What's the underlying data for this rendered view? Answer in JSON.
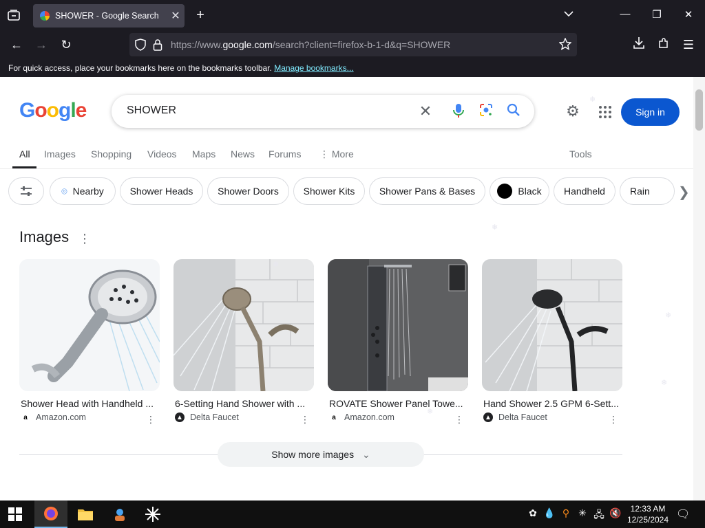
{
  "browser": {
    "tab_title": "SHOWER - Google Search",
    "url_prefix": "https://www.",
    "url_domain": "google.com",
    "url_path": "/search?client=firefox-b-1-d&q=SHOWER",
    "bookmarks_hint": "For quick access, place your bookmarks here on the bookmarks toolbar.",
    "manage_bookmarks": "Manage bookmarks..."
  },
  "google": {
    "logo": "Google",
    "query": "SHOWER",
    "sign_in": "Sign in",
    "tabs": [
      "All",
      "Images",
      "Shopping",
      "Videos",
      "Maps",
      "News",
      "Forums",
      "More"
    ],
    "tools": "Tools",
    "chips": [
      "Nearby",
      "Shower Heads",
      "Shower Doors",
      "Shower Kits",
      "Shower Pans & Bases",
      "Black",
      "Handheld",
      "Rain"
    ]
  },
  "images_section": {
    "heading": "Images",
    "cards": [
      {
        "title": "Shower Head with Handheld ...",
        "source": "Amazon.com"
      },
      {
        "title": "6-Setting Hand Shower with ...",
        "source": "Delta Faucet"
      },
      {
        "title": "ROVATE Shower Panel Towe...",
        "source": "Amazon.com"
      },
      {
        "title": "Hand Shower 2.5 GPM 6-Sett...",
        "source": "Delta Faucet"
      }
    ],
    "show_more": "Show more images"
  },
  "taskbar": {
    "time": "12:33 AM",
    "date": "12/25/2024"
  },
  "colors": {
    "browser_chrome": "#1c1b22",
    "sign_in_blue": "#0b57d0",
    "link_cyan": "#80ebff"
  }
}
